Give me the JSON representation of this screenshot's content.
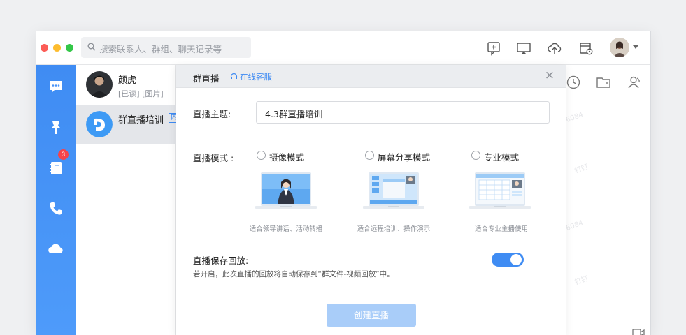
{
  "search": {
    "placeholder": "搜索联系人、群组、聊天记录等"
  },
  "toolbar": {
    "icons": [
      "add-message-icon",
      "screen-share-icon",
      "cloud-upload-icon",
      "calendar-settings-icon"
    ]
  },
  "sidebar": {
    "items": [
      {
        "icon": "message-icon"
      },
      {
        "icon": "pin-icon",
        "badge": "3"
      },
      {
        "icon": "contacts-book-icon"
      },
      {
        "icon": "phone-icon"
      },
      {
        "icon": "cloud-icon"
      }
    ]
  },
  "conversations": [
    {
      "name": "颜虎",
      "subtitle": "[已读] [图片]"
    },
    {
      "name": "群直播培训",
      "tag": "内"
    }
  ],
  "watermarks": [
    "6084",
    "钉钉",
    "6084",
    "钉钉",
    "6084",
    "钉钉"
  ],
  "modal": {
    "title": "群直播",
    "service_link": "在线客服",
    "close": "×",
    "topic_label": "直播主题:",
    "topic_value": "4.3群直播培训",
    "mode_label": "直播模式 :",
    "modes": [
      {
        "label": "摄像模式",
        "caption": "适合领导讲话、活动转播"
      },
      {
        "label": "屏幕分享模式",
        "caption": "适合远程培训、操作演示"
      },
      {
        "label": "专业模式",
        "caption": "适合专业主播使用"
      }
    ],
    "save_title": "直播保存回放:",
    "save_desc": "若开启，此次直播的回放将自动保存到“群文件-视频回放”中。",
    "save_enabled": true,
    "create_button": "创建直播"
  },
  "colors": {
    "accent": "#3f8cf3",
    "button_disabled": "#a9cdf9",
    "badge": "#f5434b"
  }
}
